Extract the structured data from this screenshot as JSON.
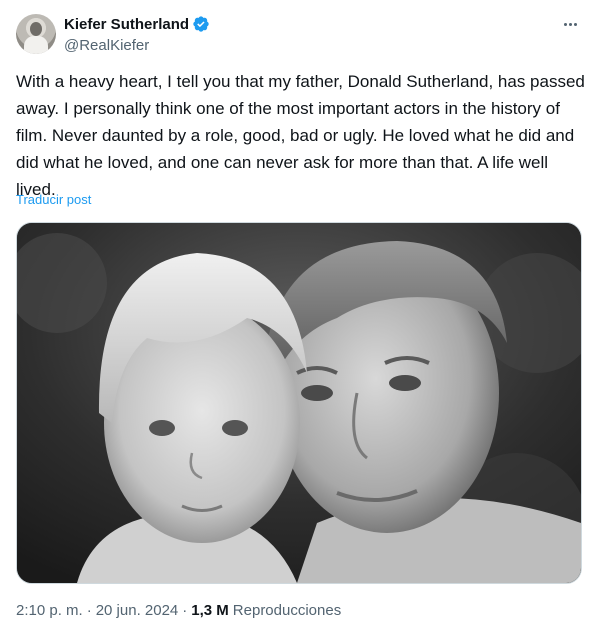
{
  "author": {
    "display_name": "Kiefer Sutherland",
    "handle": "@RealKiefer",
    "verified_icon": "verified-badge-icon",
    "avatar_icon": "profile-photo"
  },
  "more_icon": "more-options-icon",
  "tweet": {
    "text": "With a heavy heart, I tell you that my father, Donald Sutherland, has passed away. I personally think one of the most important actors in the history of film. Never daunted by a role, good, bad or ugly. He loved what he did and did what he loved, and one can never ask for more than that. A life well lived.",
    "translate_label": "Traducir post"
  },
  "meta": {
    "time": "2:10 p. m.",
    "separator": "·",
    "date": "20 jun. 2024",
    "views_count": "1,3 M",
    "views_label": "Reproducciones"
  },
  "colors": {
    "accent": "#1d9bf0",
    "text_primary": "#0f1419",
    "text_secondary": "#536471",
    "border": "#cfd9de"
  }
}
